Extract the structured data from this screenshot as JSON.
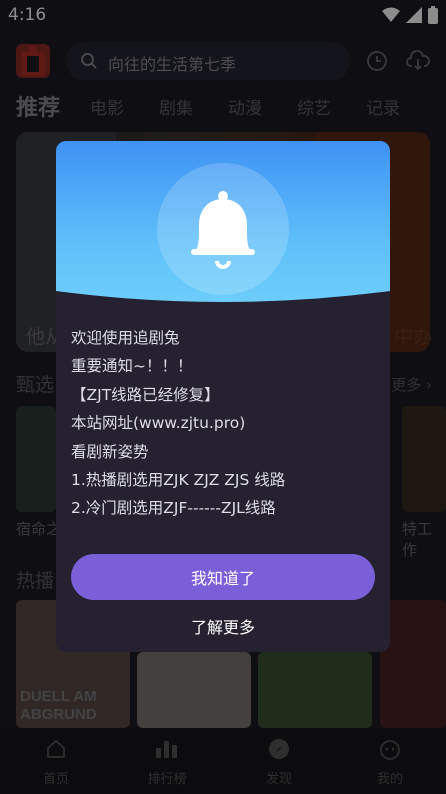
{
  "status": {
    "time": "4:16"
  },
  "search": {
    "placeholder": "向往的生活第七季"
  },
  "tabs": [
    "推荐",
    "电影",
    "剧集",
    "动漫",
    "综艺",
    "记录"
  ],
  "hero": {
    "caption_left": "他从",
    "caption_right": "中办"
  },
  "sections": {
    "featured": {
      "title": "甄选",
      "more": "更多"
    },
    "hot": {
      "title": "热播"
    }
  },
  "posters": {
    "featured_captions": [
      "宿命之",
      "特工作"
    ],
    "hot_titles": [
      "DUELL AM",
      "ABGRUND"
    ]
  },
  "dialog": {
    "lines": [
      "欢迎使用追剧兔",
      "重要通知~！！！",
      "【ZJT线路已经修复】",
      "本站网址(www.zjtu.pro)",
      "看剧新姿势",
      "1.热播剧选用ZJK ZJZ ZJS 线路",
      "2.冷门剧选用ZJF------ZJL线路"
    ],
    "confirm_label": "我知道了",
    "learn_more_label": "了解更多"
  },
  "bottom_nav": [
    "首页",
    "排行榜",
    "发现",
    "我的"
  ],
  "colors": {
    "accent": "#7b5fd9",
    "header_top": "#3f92f4",
    "header_bottom": "#6fd0fb",
    "dialog_bg": "#262131"
  }
}
